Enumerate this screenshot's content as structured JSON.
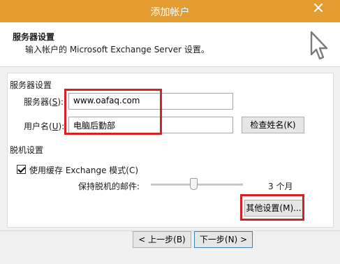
{
  "window": {
    "title": "添加帐户",
    "close_icon": "close-icon"
  },
  "header": {
    "title": "服务器设置",
    "subtitle": "输入帐户的 Microsoft Exchange Server 设置。",
    "icon": "cursor-arrow-icon"
  },
  "server_section": {
    "label": "服务器设置",
    "server": {
      "label_prefix": "服务器(",
      "accesskey": "S",
      "label_suffix": "):",
      "value": "www.oafaq.com"
    },
    "username": {
      "label_prefix": "用户名(",
      "accesskey": "U",
      "label_suffix": "):",
      "value": "电脑后勤部"
    },
    "check_name_button": "检查姓名(K)"
  },
  "offline_section": {
    "label": "脱机设置",
    "cached_mode": {
      "checked": true,
      "label": "使用缓存 Exchange 模式(C)"
    },
    "keep_offline_label": "保持脱机的邮件:",
    "keep_offline_value": "3 个月",
    "more_settings_button": "其他设置(M)..."
  },
  "footer": {
    "back_button": "< 上一步(B)",
    "next_button": "下一步(N) >"
  },
  "colors": {
    "titlebar": "#e49b2f",
    "highlight": "#d42128"
  }
}
